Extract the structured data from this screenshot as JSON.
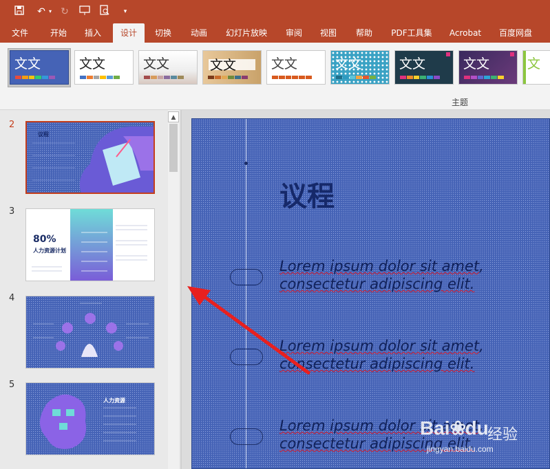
{
  "tabs": [
    "文件",
    "开始",
    "插入",
    "设计",
    "切换",
    "动画",
    "幻灯片放映",
    "审阅",
    "视图",
    "帮助",
    "PDF工具集",
    "Acrobat",
    "百度网盘"
  ],
  "active_tab": "设计",
  "ribbon": {
    "theme_sample": "文文",
    "group_label": "主题",
    "partial_theme_sample": "文"
  },
  "thumbnails": {
    "numbers": [
      "2",
      "3",
      "4",
      "5"
    ],
    "slide2_title": "议程",
    "slide3_percent": "80%",
    "slide3_title": "人力资源计划",
    "slide5_title": "人力资源"
  },
  "slide": {
    "title": "议程",
    "items": [
      {
        "line1_a": "Lorem ipsum dolor sit ",
        "line1_b": "amet",
        "line1_c": ",",
        "line2": "consectetur adipiscing elit."
      },
      {
        "line1_a": "Lorem ipsum dolor sit ",
        "line1_b": "amet",
        "line1_c": ",",
        "line2": "consectetur adipiscing elit."
      },
      {
        "line1_a": "Lorem ipsum dolor sit ",
        "line1_b": "amet",
        "line1_c": ",",
        "line2": "consectetur adipiscing elit."
      }
    ]
  },
  "watermark": {
    "brand": "Bai",
    "brand2": "du",
    "jingyan": "经验",
    "url": "jingyan.baidu.com"
  },
  "colors": {
    "accent": "#b7472a",
    "slide_bg": "#4563b6",
    "arrow": "#e8201f"
  }
}
